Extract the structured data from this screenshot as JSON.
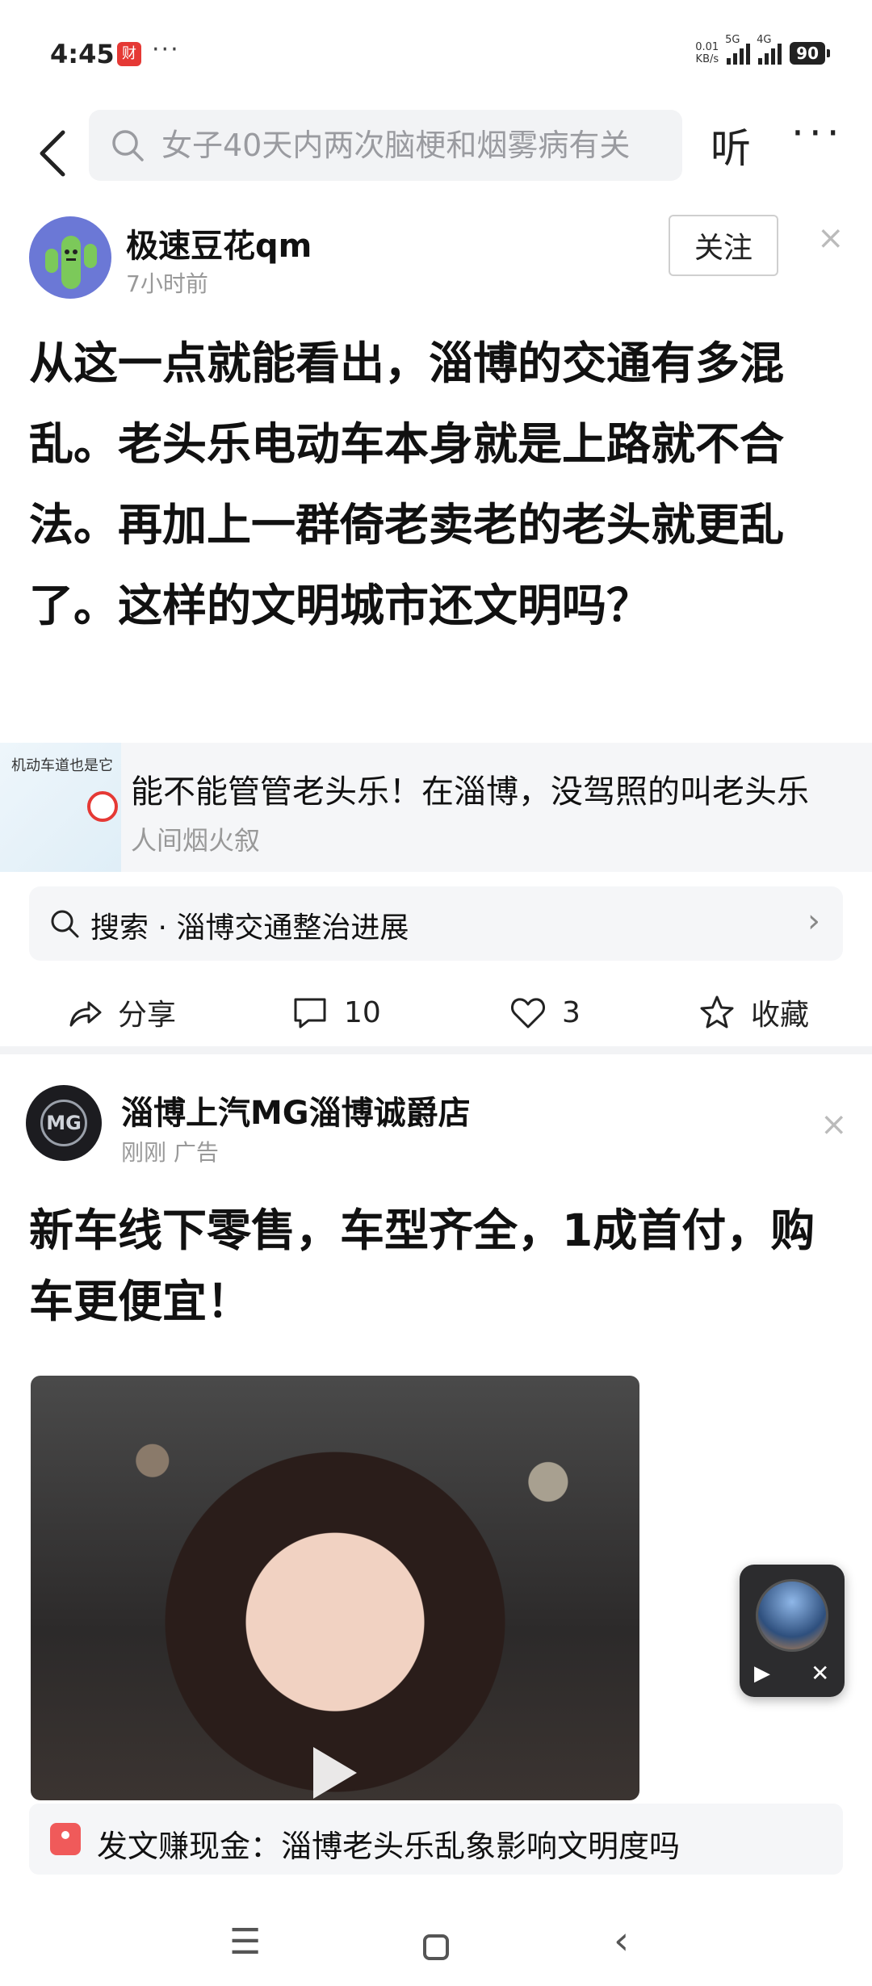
{
  "status_bar": {
    "time": "4:45",
    "more": "···",
    "net_speed_value": "0.01",
    "net_speed_unit": "KB/s",
    "signal1_label": "5G",
    "signal2_label": "4G",
    "battery": "90"
  },
  "topnav": {
    "search_placeholder": "女子40天内两次脑梗和烟雾病有关",
    "listen_label": "听",
    "more_label": "···"
  },
  "post1": {
    "author": "极速豆花qm",
    "time": "7小时前",
    "follow_label": "关注",
    "close_label": "×",
    "body": "从这一点就能看出，淄博的交通有多混乱。老头乐电动车本身就是上路就不合法。再加上一群倚老卖老的老头就更乱了。这样的文明城市还文明吗？",
    "linked": {
      "thumb_text": "机动车道也是它",
      "title": "能不能管管老头乐！在淄博，没驾照的叫老头乐",
      "source": "人间烟火叙"
    },
    "search_suggest": "搜索 · 淄博交通整治进展",
    "chevron": "›",
    "actions": {
      "share": "分享",
      "comments": "10",
      "likes": "3",
      "favorite": "收藏"
    }
  },
  "post2": {
    "author": "淄博上汽MG淄博诚爵店",
    "meta": "刚刚  广告",
    "avatar_text": "MG",
    "close_label": "×",
    "body": "新车线下零售，车型齐全，1成首付，购车更便宜！"
  },
  "float_player": {
    "play": "▶",
    "close": "✕"
  },
  "promo": {
    "text": "发文赚现金：淄博老头乐乱象影响文明度吗"
  },
  "navbar": {
    "menu": "☰",
    "back": "‹"
  },
  "colors": {
    "accent_red": "#e53935",
    "muted_text": "#999999",
    "card_bg": "#f5f6f8"
  }
}
